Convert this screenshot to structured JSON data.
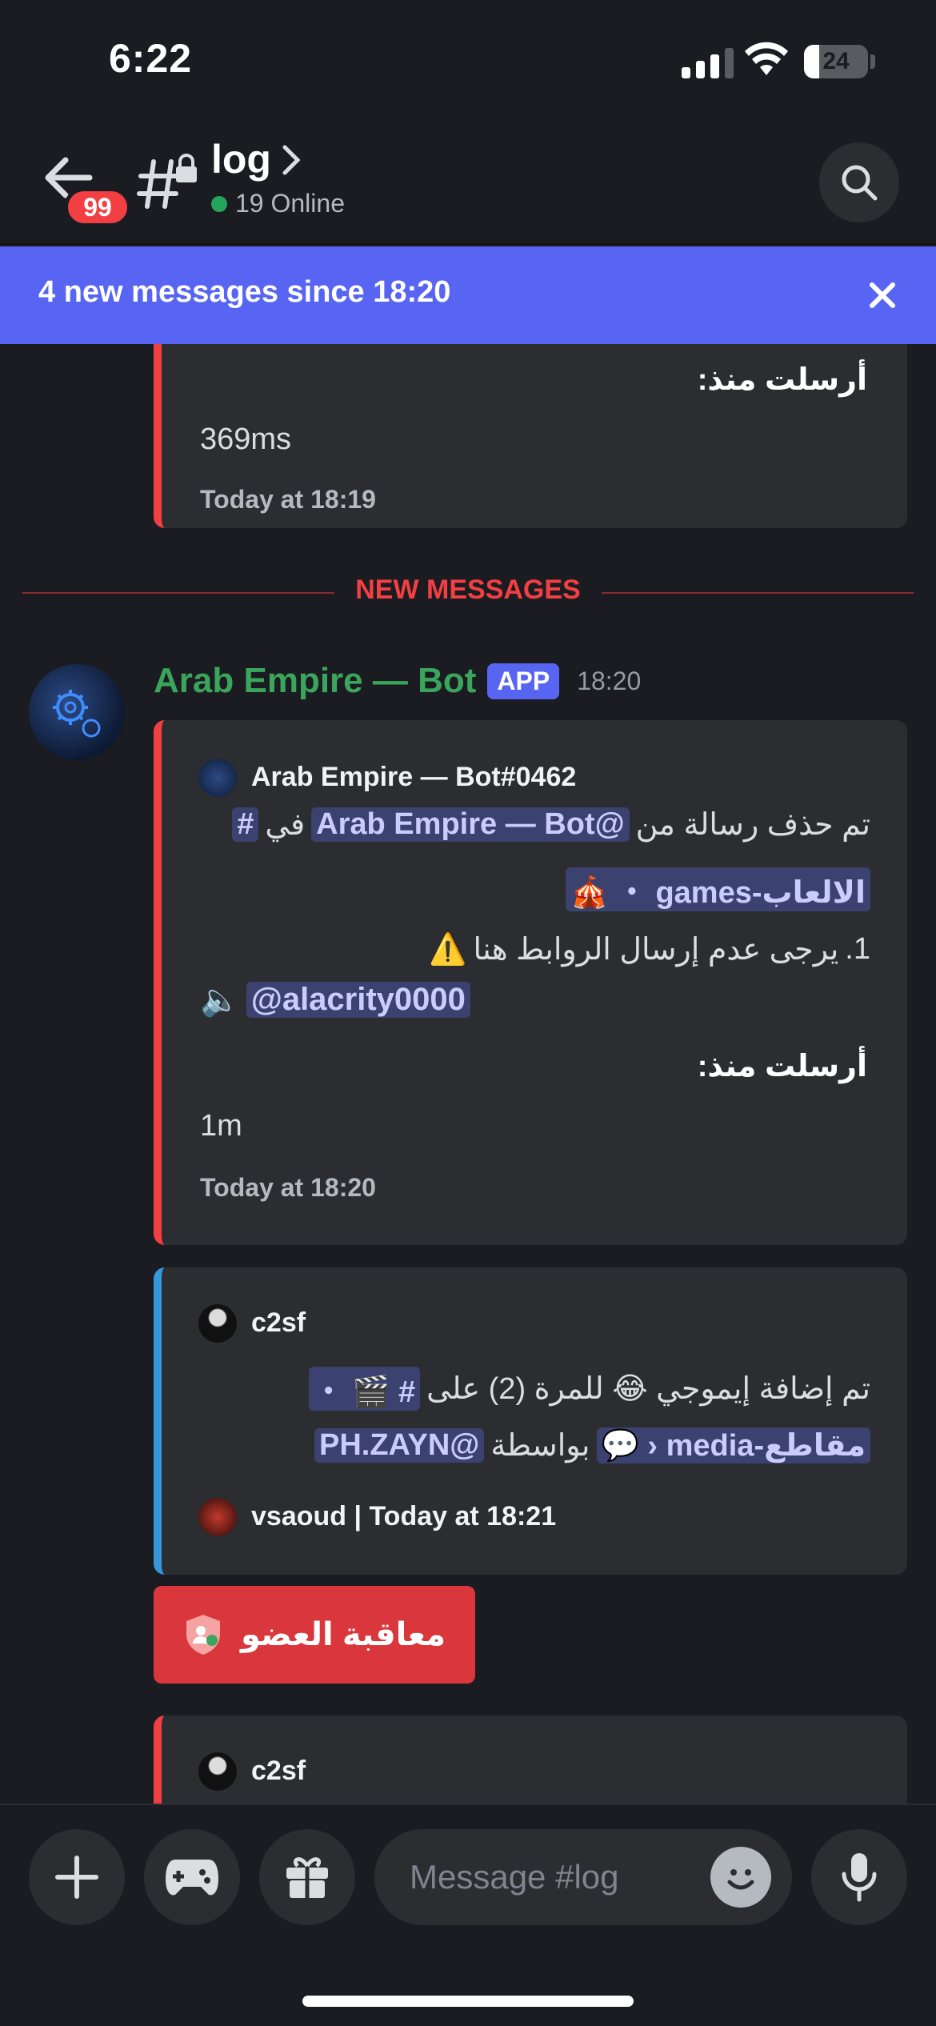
{
  "status_bar": {
    "time": "6:22",
    "battery": "24",
    "battery_level": 0.24
  },
  "header": {
    "back_badge": "99",
    "channel_name": "log",
    "online_text": "19 Online"
  },
  "banner": {
    "text": "4 new messages since 18:20"
  },
  "chat": {
    "prev_embed": {
      "label": "أرسلت منذ:",
      "value": "369ms",
      "footer": "Today at 18:19"
    },
    "divider": "NEW MESSAGES",
    "message": {
      "author": "Arab Empire — Bot",
      "tag": "APP",
      "time": "18:20",
      "embed1": {
        "author": "Arab Empire — Bot#0462",
        "line1_prefix": "تم حذف رسالة من",
        "line1_mention": "@Arab Empire — Bot",
        "line1_in": "في",
        "line1_hash": "#",
        "line2_channel": "الالعاب-games ・",
        "line2_emoji": "🎪",
        "line3_num": "1.",
        "line3_text": "يرجى عدم إرسال الروابط هنا",
        "line3_emoji": "⚠️",
        "mention_emoji": "🔈",
        "mention": "@alacrity0000",
        "label": "أرسلت منذ:",
        "value": "1m",
        "footer": "Today at 18:20"
      },
      "embed2": {
        "author": "c2sf",
        "line1_text": "تم إضافة إيموجي 😂 للمرة (2) على",
        "line1_channel": "# 🎬 ・",
        "line2_channel": "مقاطع-media ‹ 💬",
        "line2_by": "بواسطة",
        "line2_mention": "@PH.ZAYN",
        "footer": "vsaoud | Today at 18:21"
      },
      "button_label": "معاقبة العضو",
      "embed3_author": "c2sf"
    }
  },
  "composer": {
    "placeholder": "Message #log"
  },
  "colors": {
    "accent": "#5865f2",
    "danger": "#f23f43",
    "bot_name": "#3ba55c",
    "bg": "#1b1c21"
  }
}
